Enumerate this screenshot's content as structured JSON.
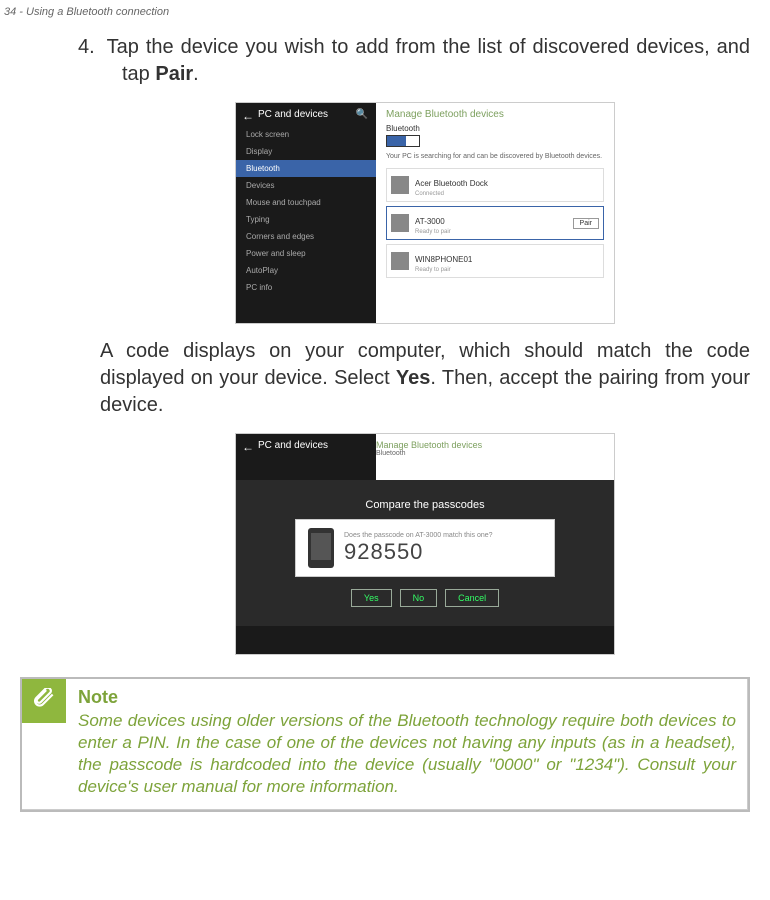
{
  "running_header": "34 - Using a Bluetooth connection",
  "step": {
    "number": "4.",
    "text_before_bold": "Tap the device you wish to add from the list of discovered devices, and tap ",
    "bold": "Pair",
    "after": "."
  },
  "screenshot1": {
    "panel_title": "PC and devices",
    "sidebar_items": [
      "Lock screen",
      "Display",
      "Bluetooth",
      "Devices",
      "Mouse and touchpad",
      "Typing",
      "Corners and edges",
      "Power and sleep",
      "AutoPlay",
      "PC info"
    ],
    "sidebar_active_index": 2,
    "manage_title": "Manage Bluetooth devices",
    "bt_label": "Bluetooth",
    "toggle_state": "On",
    "desc": "Your PC is searching for and can be discovered by Bluetooth devices.",
    "devices": [
      {
        "name": "Acer Bluetooth Dock",
        "sub": "Connected"
      },
      {
        "name": "AT-3000",
        "sub": "Ready to pair"
      },
      {
        "name": "WIN8PHONE01",
        "sub": "Ready to pair"
      }
    ],
    "pair_button": "Pair"
  },
  "mid_para": {
    "before_yes": "A code displays on your computer, which should match the code displayed on your device. Select ",
    "yes": "Yes",
    "after_yes": ". Then, accept the pairing from your device."
  },
  "screenshot2": {
    "panel_title": "PC and devices",
    "manage_title": "Manage Bluetooth devices",
    "bt_label": "Bluetooth",
    "compare": "Compare the passcodes",
    "hint": "Does the passcode on AT-3000 match this one?",
    "code": "928550",
    "buttons": [
      "Yes",
      "No",
      "Cancel"
    ]
  },
  "note": {
    "title": "Note",
    "body": "Some devices using older versions of the Bluetooth technology require both devices to enter a PIN. In the case of one of the devices not having any inputs (as in a headset), the passcode is hardcoded into the device (usually \"0000\" or \"1234\"). Consult your device's user manual for more information."
  }
}
